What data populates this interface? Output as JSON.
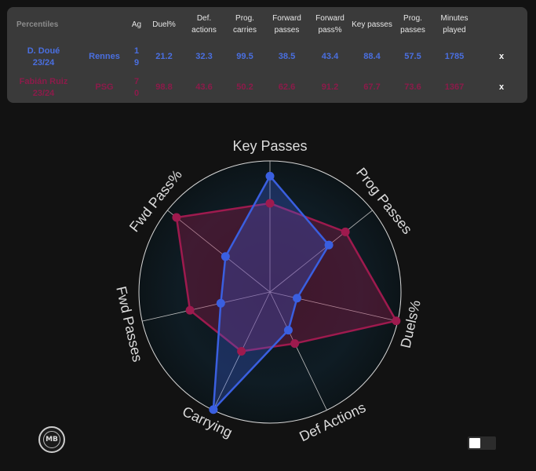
{
  "table": {
    "headers": [
      "Percentiles",
      "Ag",
      "Duel%",
      "Def. actions",
      "Prog. carries",
      "Forward passes",
      "Forward pass%",
      "Key passes",
      "Prog. passes",
      "Minutes played"
    ],
    "rows": [
      {
        "name": "D. Doué",
        "season": "23/24",
        "team": "Rennes",
        "age_top": "1",
        "age_bottom": "9",
        "values": [
          "21.2",
          "32.3",
          "99.5",
          "38.5",
          "43.4",
          "88.4",
          "57.5",
          "1785"
        ],
        "remove": "x"
      },
      {
        "name": "Fabián Ruiz",
        "season": "23/24",
        "team": "PSG",
        "age_top": "7",
        "age_bottom": "0",
        "values": [
          "98.8",
          "43.6",
          "50.2",
          "62.6",
          "91.2",
          "67.7",
          "73.6",
          "1367"
        ],
        "remove": "x"
      }
    ]
  },
  "colors": {
    "player1": "#3a5fe0",
    "player2": "#9e1a4e",
    "panel": "#3a3a3a",
    "background": "#121212"
  },
  "logo": {
    "text": "MB",
    "icon": "mb-logo-icon"
  },
  "chart_data": {
    "type": "radar",
    "axes": [
      "Key Passes",
      "Prog Passes",
      "Duels%",
      "Def Actions",
      "Carrying",
      "Fwd Passes",
      "Fwd Pass%"
    ],
    "range": [
      0,
      100
    ],
    "series": [
      {
        "name": "D. Doué",
        "color": "#3a5fe0",
        "values": [
          88.4,
          57.5,
          21.2,
          32.3,
          99.5,
          38.5,
          43.4
        ]
      },
      {
        "name": "Fabián Ruiz",
        "color": "#9e1a4e",
        "values": [
          67.7,
          73.6,
          98.8,
          43.6,
          50.2,
          62.6,
          91.2
        ]
      }
    ]
  }
}
